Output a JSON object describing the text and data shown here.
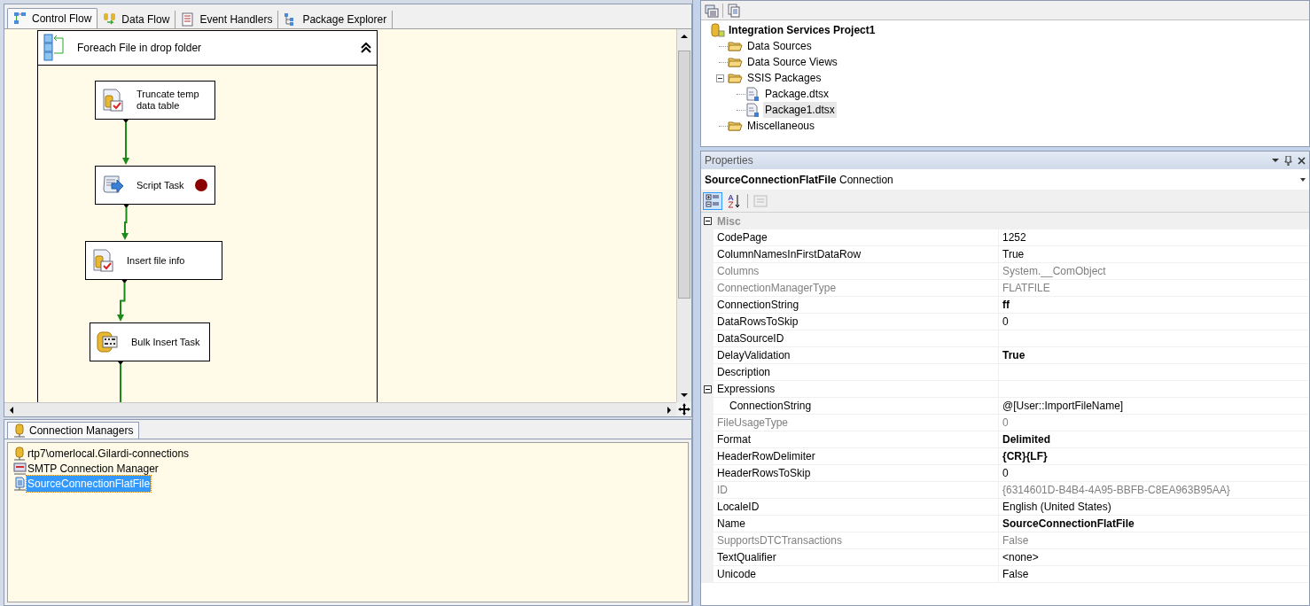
{
  "designer_tabs": [
    {
      "label": "Control Flow",
      "kind": "control",
      "selected": true
    },
    {
      "label": "Data Flow",
      "kind": "dataflow",
      "selected": false
    },
    {
      "label": "Event Handlers",
      "kind": "events",
      "selected": false
    },
    {
      "label": "Package Explorer",
      "kind": "explorer",
      "selected": false
    }
  ],
  "container": {
    "title": "Foreach File in drop folder",
    "expanded": true
  },
  "tasks": [
    {
      "label": "Truncate temp\ndata table",
      "kind": "sql",
      "breakpoint": false
    },
    {
      "label": "Script Task",
      "kind": "script",
      "breakpoint": true
    },
    {
      "label": "Insert file info",
      "kind": "sql",
      "breakpoint": false
    },
    {
      "label": "Bulk Insert Task",
      "kind": "bulk",
      "breakpoint": false
    }
  ],
  "connection_managers": {
    "tab": "Connection Managers",
    "items": [
      {
        "label": "rtp7\\omerlocal.Gilardi-connections",
        "kind": "db",
        "selected": false
      },
      {
        "label": "SMTP Connection Manager",
        "kind": "smtp",
        "selected": false
      },
      {
        "label": "SourceConnectionFlatFile",
        "kind": "file",
        "selected": true
      }
    ]
  },
  "solution_explorer": {
    "root": {
      "label": "Integration Services Project1",
      "children": [
        {
          "label": "Data Sources",
          "kind": "folder",
          "selected": false
        },
        {
          "label": "Data Source Views",
          "kind": "folder",
          "selected": false
        },
        {
          "label": "SSIS Packages",
          "kind": "folder",
          "expanded": true,
          "selected": false,
          "children": [
            {
              "label": "Package.dtsx",
              "kind": "package",
              "selected": false
            },
            {
              "label": "Package1.dtsx",
              "kind": "package",
              "selected": true
            }
          ]
        },
        {
          "label": "Miscellaneous",
          "kind": "folder",
          "selected": false
        }
      ]
    }
  },
  "properties": {
    "title": "Properties",
    "object_name": "SourceConnectionFlatFile",
    "object_type": "Connection",
    "categorized": true,
    "categories": [
      {
        "name": "Misc",
        "expanded": true,
        "rows": [
          {
            "name": "CodePage",
            "value": "1252",
            "readonly": false,
            "modified": false
          },
          {
            "name": "ColumnNamesInFirstDataRow",
            "value": "True",
            "readonly": false,
            "modified": false
          },
          {
            "name": "Columns",
            "value": "System.__ComObject",
            "readonly": true,
            "modified": false
          },
          {
            "name": "ConnectionManagerType",
            "value": "FLATFILE",
            "readonly": true,
            "modified": false
          },
          {
            "name": "ConnectionString",
            "value": "ff",
            "readonly": false,
            "modified": true
          },
          {
            "name": "DataRowsToSkip",
            "value": "0",
            "readonly": false,
            "modified": false
          },
          {
            "name": "DataSourceID",
            "readonly": false
          },
          {
            "name": "DelayValidation",
            "value": "True",
            "readonly": false,
            "modified": true
          },
          {
            "name": "Description",
            "readonly": false
          },
          {
            "name": "Expressions",
            "readonly": false,
            "expanded": true,
            "children": [
              {
                "name": "ConnectionString",
                "value": "@[User::ImportFileName]",
                "readonly": false,
                "modified": false
              }
            ]
          },
          {
            "name": "FileUsageType",
            "value": "0",
            "readonly": true,
            "modified": false
          },
          {
            "name": "Format",
            "value": "Delimited",
            "readonly": false,
            "modified": true
          },
          {
            "name": "HeaderRowDelimiter",
            "value": "{CR}{LF}",
            "readonly": false,
            "modified": true
          },
          {
            "name": "HeaderRowsToSkip",
            "value": "0",
            "readonly": false,
            "modified": false
          },
          {
            "name": "ID",
            "value": "{6314601D-B4B4-4A95-BBFB-C8EA963B95AA}",
            "readonly": true,
            "modified": false
          },
          {
            "name": "LocaleID",
            "value": "English (United States)",
            "readonly": false,
            "modified": false
          },
          {
            "name": "Name",
            "value": "SourceConnectionFlatFile",
            "readonly": false,
            "modified": true
          },
          {
            "name": "SupportsDTCTransactions",
            "value": "False",
            "readonly": true,
            "modified": false
          },
          {
            "name": "TextQualifier",
            "value": "<none>",
            "readonly": false,
            "modified": false
          },
          {
            "name": "Unicode",
            "value": "False",
            "readonly": false,
            "modified": false
          }
        ]
      }
    ]
  }
}
